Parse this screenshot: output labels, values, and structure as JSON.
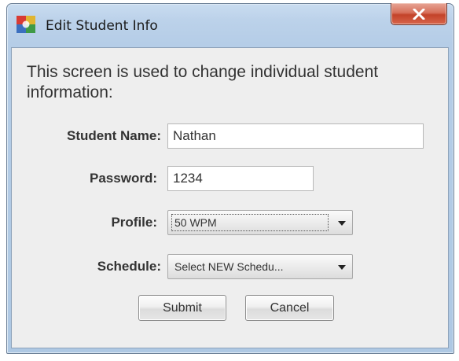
{
  "window": {
    "title": "Edit Student Info",
    "close_icon": "close-x-icon"
  },
  "form": {
    "intro": "This screen is used to change individual student information:",
    "student_name": {
      "label": "Student Name:",
      "value": "Nathan"
    },
    "password": {
      "label": "Password:",
      "value": "1234"
    },
    "profile": {
      "label": "Profile:",
      "selected": "50 WPM"
    },
    "schedule": {
      "label": "Schedule:",
      "selected": "Select NEW Schedu..."
    },
    "submit_label": "Submit",
    "cancel_label": "Cancel"
  },
  "colors": {
    "frame": "#b5cde7",
    "client": "#eeeeee",
    "close_button": "#c3432a"
  }
}
